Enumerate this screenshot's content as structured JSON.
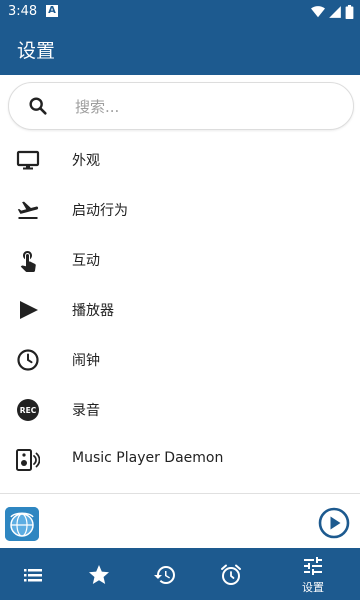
{
  "status_bar": {
    "time": "3:48",
    "notification_glyph": "A",
    "right_icons": [
      "wifi-icon",
      "signal-icon",
      "battery-icon"
    ]
  },
  "app_bar": {
    "title": "设置"
  },
  "search": {
    "placeholder": "搜索..."
  },
  "menu": [
    {
      "label": "外观",
      "icon": "monitor-icon"
    },
    {
      "label": "启动行为",
      "icon": "plane-takeoff-icon"
    },
    {
      "label": "互动",
      "icon": "touch-icon"
    },
    {
      "label": "播放器",
      "icon": "play-icon"
    },
    {
      "label": "闹钟",
      "icon": "clock-icon"
    },
    {
      "label": "录音",
      "icon": "rec-icon"
    },
    {
      "label": "Music Player Daemon",
      "icon": "speaker-icon"
    }
  ],
  "player": {
    "album_art": "radio-globe-icon",
    "control": "play-circle-icon"
  },
  "bottom_nav": [
    {
      "icon": "list-icon",
      "label": ""
    },
    {
      "icon": "star-icon",
      "label": ""
    },
    {
      "icon": "history-icon",
      "label": ""
    },
    {
      "icon": "alarm-icon",
      "label": ""
    },
    {
      "icon": "settings-sliders-icon",
      "label": "设置"
    }
  ],
  "colors": {
    "primary": "#1d5a8f",
    "background": "#ffffff",
    "text": "#222222",
    "hint": "#9e9e9e"
  }
}
